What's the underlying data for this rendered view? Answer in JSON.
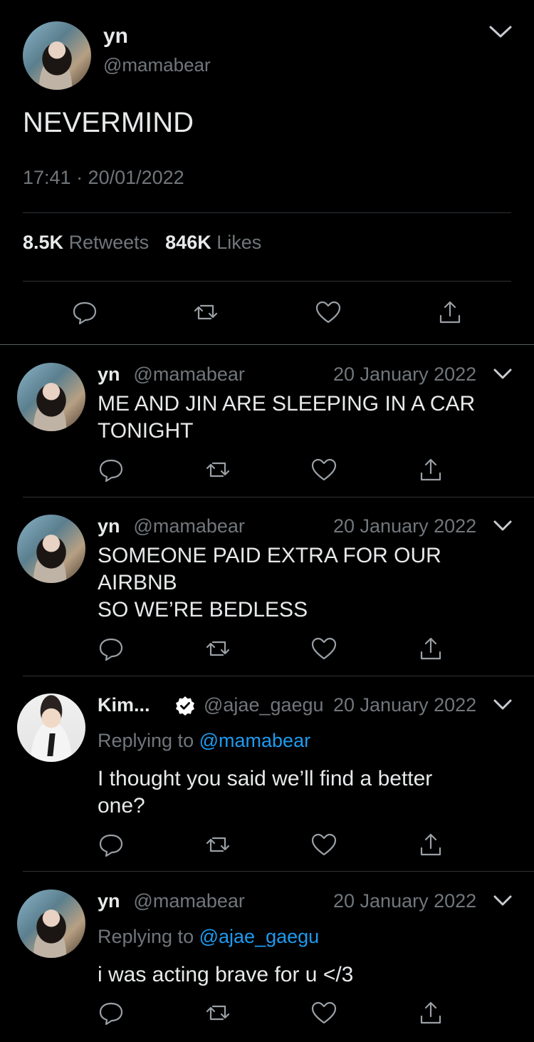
{
  "main_tweet": {
    "author_name": "yn",
    "handle": "@mamabear",
    "text": "NEVERMIND",
    "timestamp": "17:41 · 20/01/2022",
    "retweets_count": "8.5K",
    "retweets_label": "Retweets",
    "likes_count": "846K",
    "likes_label": "Likes",
    "actions": [
      "reply-icon",
      "retweet-icon",
      "like-icon",
      "share-icon"
    ]
  },
  "replies": [
    {
      "author_name": "yn",
      "handle": "@mamabear",
      "date": "20 January 2022",
      "lines": [
        "ME AND JIN ARE SLEEPING IN A CAR",
        "TONIGHT"
      ]
    },
    {
      "author_name": "yn",
      "handle": "@mamabear",
      "date": "20 January 2022",
      "lines": [
        "SOMEONE PAID EXTRA FOR OUR",
        "AIRBNB",
        "SO WE’RE BEDLESS"
      ]
    },
    {
      "author_name": "Kim...",
      "verified": true,
      "handle": "@ajae_gaegu",
      "date": "20 January 2022",
      "replying_label": "Replying to",
      "replying_to": "@mamabear",
      "lines": [
        "I thought you said we’ll find a better",
        "one?"
      ]
    },
    {
      "author_name": "yn",
      "handle": "@mamabear",
      "date": "20 January 2022",
      "replying_label": "Replying to",
      "replying_to": "@ajae_gaegu",
      "lines": [
        "i was acting brave for u </3"
      ]
    }
  ],
  "colors": {
    "background": "#000000",
    "text": "#e7e9ea",
    "secondary": "#71767b",
    "link": "#1d9bf0",
    "divider": "#2f3336"
  }
}
